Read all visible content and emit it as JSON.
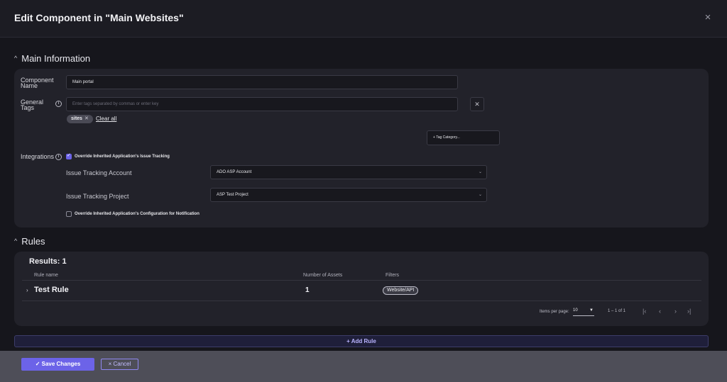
{
  "dialog": {
    "title": "Edit Component in \"Main Websites\"",
    "close_icon": "×"
  },
  "main_info": {
    "section_title": "Main Information",
    "component_name_label_1": "Component",
    "component_name_label_2": "Name",
    "component_name_value": "Main portal",
    "general_tags_label_1": "General",
    "general_tags_label_2": "Tags",
    "tags_placeholder": "Enter tags separated by commas or enter key",
    "tag_chip": "sites",
    "clear_all": "Clear all",
    "tag_category_button": "+ Tag Category...",
    "integrations_label": "Integrations",
    "override_issue_tracking": "Override Inherited Application's Issue Tracking",
    "issue_tracking_account_label": "Issue Tracking Account",
    "issue_tracking_account_value": "ADO ASP Account",
    "issue_tracking_project_label": "Issue Tracking Project",
    "issue_tracking_project_value": "ASP Test Project",
    "override_notification": "Override Inherited Application's Configuration for Notification"
  },
  "rules": {
    "section_title": "Rules",
    "results": "Results: 1",
    "columns": [
      "Rule name",
      "Number of Assets",
      "Filters"
    ],
    "rows": [
      {
        "name": "Test Rule",
        "assets": "1",
        "filter": "Website/API"
      }
    ],
    "items_per_page_label": "Items per page:",
    "items_per_page": "10",
    "range": "1 – 1 of 1",
    "add_rule": "+ Add Rule"
  },
  "footer": {
    "save": "✓ Save Changes",
    "cancel": "× Cancel"
  },
  "colors": {
    "accent": "#6c63e8",
    "background": "#16161c",
    "card": "#22222a"
  }
}
